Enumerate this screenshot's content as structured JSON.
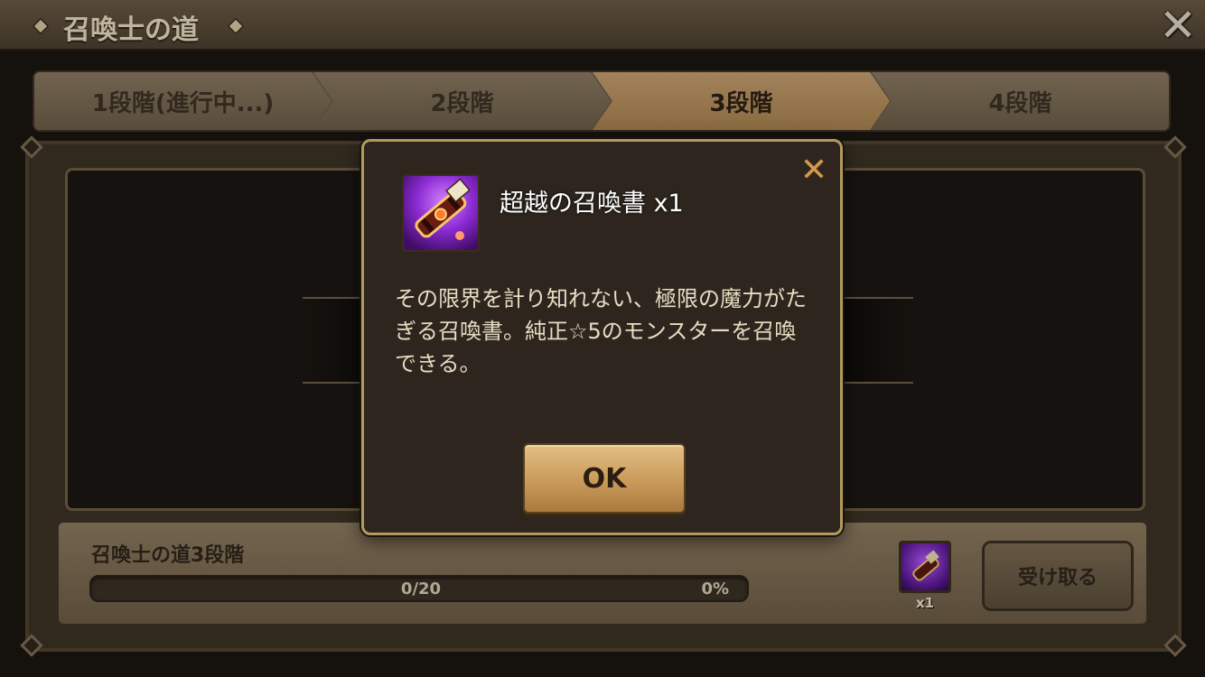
{
  "header": {
    "title": "召喚士の道",
    "close_icon": "close-x-icon"
  },
  "stages": [
    {
      "label": "1段階(進行中...)",
      "active": false
    },
    {
      "label": "2段階",
      "active": false
    },
    {
      "label": "3段階",
      "active": true
    },
    {
      "label": "4段階",
      "active": false
    }
  ],
  "mission": {
    "title": "召喚士の道3段階",
    "progress_count": "0/20",
    "progress_percent": "0%",
    "progress_value": 0,
    "reward_quantity": "x1",
    "reward_icon": "transcendence-scroll-icon",
    "claim_label": "受け取る"
  },
  "modal": {
    "item_name": "超越の召喚書 x1",
    "item_icon": "transcendence-scroll-icon",
    "description": "その限界を計り知れない、極限の魔力がたぎる召喚書。純正☆5のモンスターを召喚できる。",
    "ok_label": "OK"
  },
  "colors": {
    "accent_gold": "#b29a5e",
    "active_tab": "#c7a070",
    "item_purple": "#8a2ad1"
  }
}
